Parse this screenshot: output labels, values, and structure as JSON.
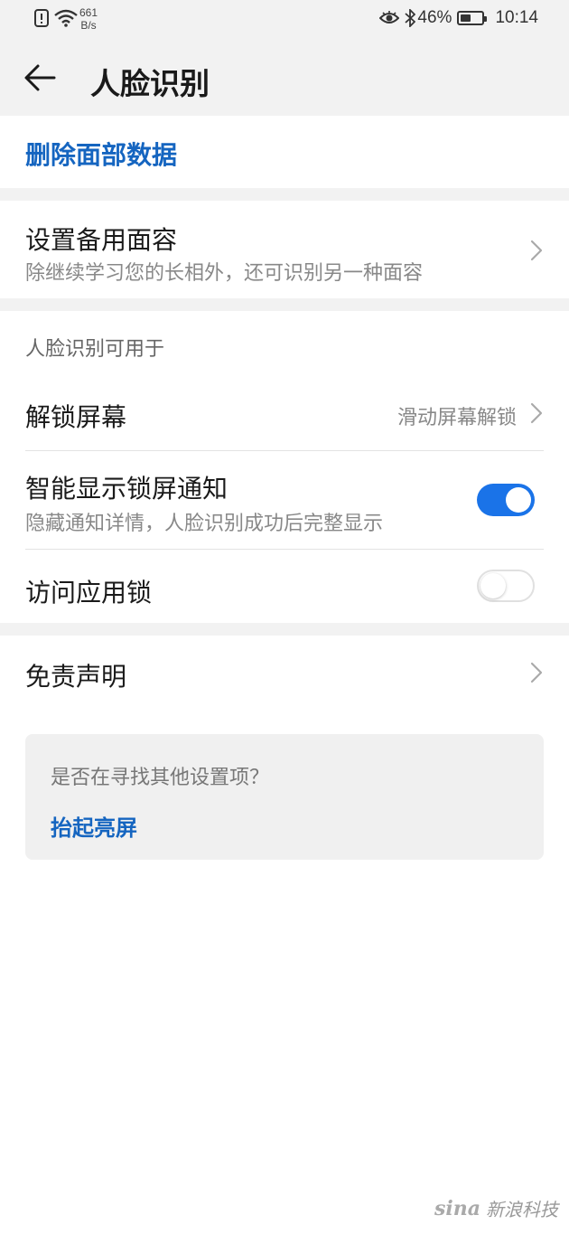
{
  "status_bar": {
    "net_speed_value": "661",
    "net_speed_unit": "B/s",
    "battery_percent": "46%",
    "battery_level": 0.46,
    "time": "10:14"
  },
  "header": {
    "title": "人脸识别"
  },
  "delete_section": {
    "label": "删除面部数据"
  },
  "alt_face": {
    "title": "设置备用面容",
    "subtitle": "除继续学习您的长相外，还可识别另一种面容"
  },
  "usage_section": {
    "label": "人脸识别可用于",
    "items": [
      {
        "title": "解锁屏幕",
        "value": "滑动屏幕解锁"
      },
      {
        "title": "智能显示锁屏通知",
        "subtitle": "隐藏通知详情，人脸识别成功后完整显示",
        "toggle": true
      },
      {
        "title": "访问应用锁",
        "toggle": false
      }
    ]
  },
  "disclaimer": {
    "title": "免责声明"
  },
  "suggestion": {
    "question": "是否在寻找其他设置项？",
    "link": "抬起亮屏"
  },
  "watermark": {
    "logo": "sina",
    "text": "新浪科技"
  },
  "colors": {
    "accent": "#1a73e8",
    "link": "#1565c0",
    "background_gray": "#f2f2f2"
  }
}
